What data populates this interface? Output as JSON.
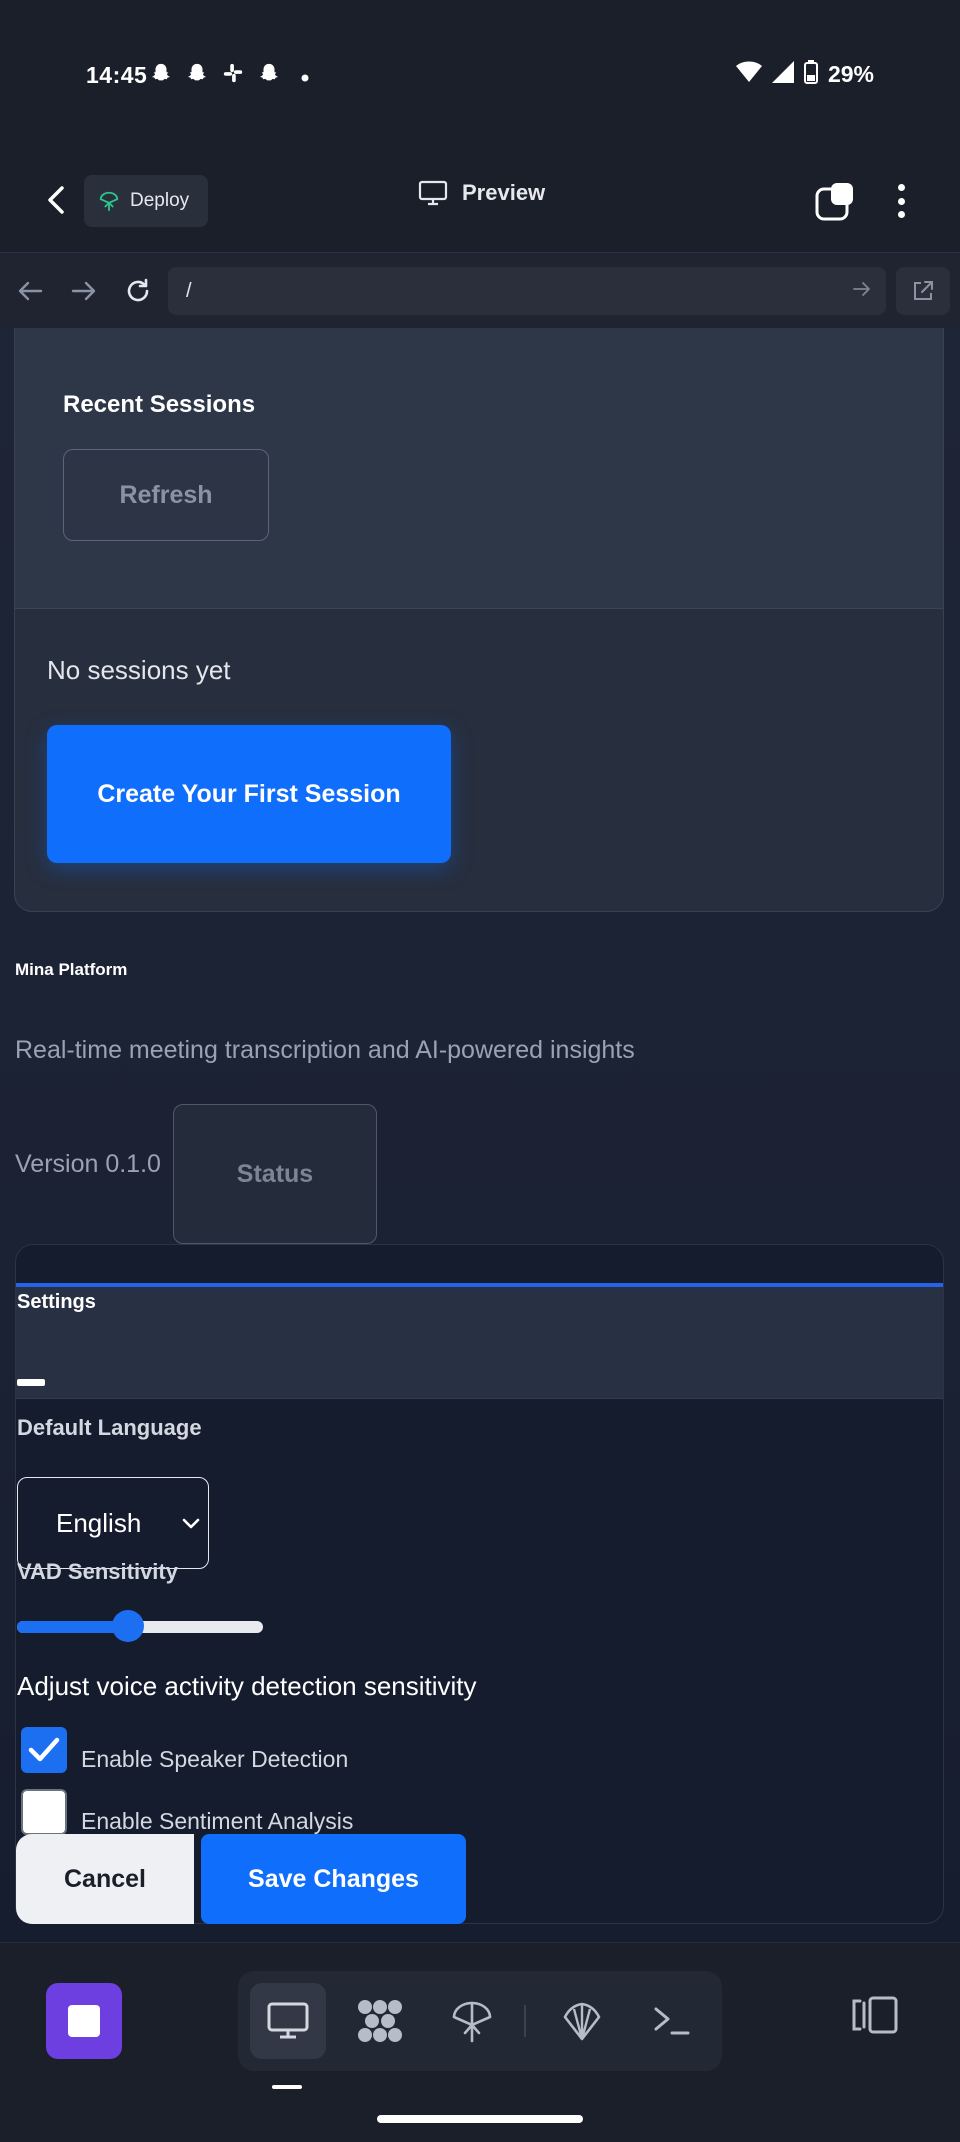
{
  "status_bar": {
    "time": "14:45",
    "notification_icons": [
      "snapchat-icon",
      "snapchat-icon",
      "slack-icon",
      "snapchat-icon",
      "dot-icon"
    ],
    "battery": "29%"
  },
  "header": {
    "deploy_label": "Deploy",
    "title": "Preview"
  },
  "browser": {
    "url": "/"
  },
  "sessions": {
    "title": "Recent Sessions",
    "refresh_label": "Refresh",
    "empty_text": "No sessions yet",
    "create_label": "Create Your First Session"
  },
  "platform": {
    "name": "Mina Platform",
    "tagline": "Real-time meeting transcription and AI-powered insights",
    "version": "Version 0.1.0",
    "status_label": "Status"
  },
  "settings": {
    "title": "Settings",
    "language_label": "Default Language",
    "language_value": "English",
    "vad_label": "VAD Sensitivity",
    "vad_value": 0.45,
    "vad_help": "Adjust voice activity detection sensitivity",
    "speaker_detection_label": "Enable Speaker Detection",
    "speaker_detection_checked": true,
    "sentiment_label": "Enable Sentiment Analysis",
    "sentiment_checked": false,
    "cancel_label": "Cancel",
    "save_label": "Save Changes"
  },
  "colors": {
    "accent": "#0f6efb",
    "stop_button": "#6d3ee0",
    "background": "#1b2030"
  },
  "bottom_bar": {
    "tools": [
      "desktop-icon",
      "workflow-icon",
      "deploy-icon",
      "shell-icon",
      "terminal-icon"
    ],
    "active_tool": "desktop-icon"
  }
}
